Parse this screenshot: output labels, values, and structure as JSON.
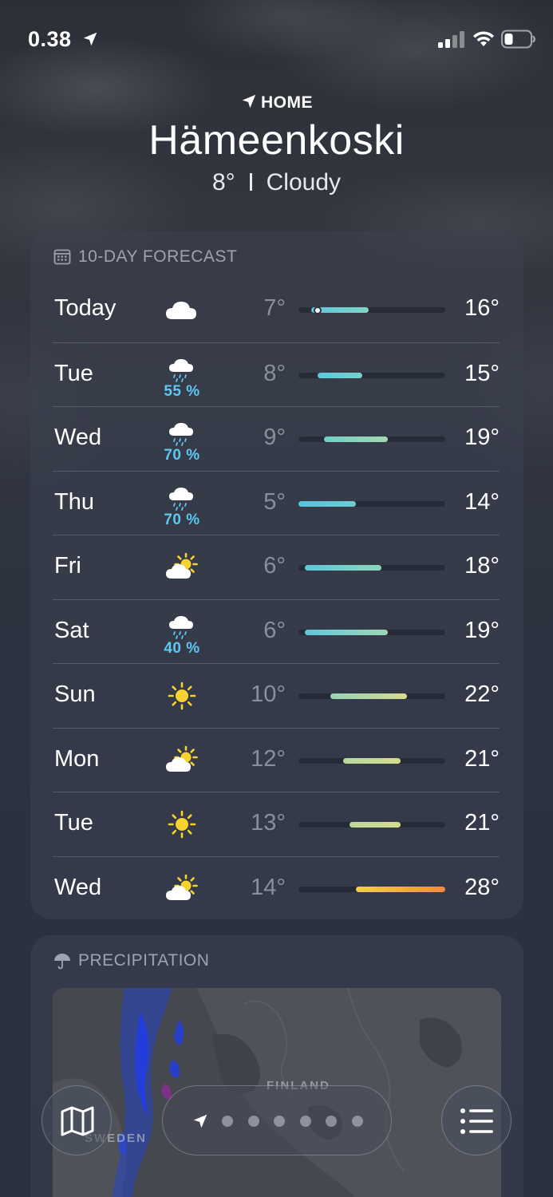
{
  "status_bar": {
    "time": "0.38",
    "location_icon": "location-arrow-icon",
    "signal_icon": "cellular-signal-icon",
    "wifi_icon": "wifi-icon",
    "battery_icon": "battery-icon"
  },
  "location": {
    "label": "HOME",
    "city": "Hämeenkoski",
    "current_temp": "8°",
    "condition": "Cloudy"
  },
  "forecast": {
    "header": "10-DAY FORECAST",
    "icon": "calendar-icon",
    "scale": {
      "min": 5,
      "max": 28
    },
    "days": [
      {
        "day": "Today",
        "icon": "cloud-icon",
        "pop": "",
        "low": "7°",
        "high": "16°",
        "low_val": 7,
        "high_val": 16,
        "current": 8,
        "colors": [
          "#5ec8dc",
          "#7ed4c8"
        ]
      },
      {
        "day": "Tue",
        "icon": "cloud-rain-icon",
        "pop": "55 %",
        "low": "8°",
        "high": "15°",
        "low_val": 8,
        "high_val": 15,
        "colors": [
          "#5ec8dc",
          "#78d0cc"
        ]
      },
      {
        "day": "Wed",
        "icon": "cloud-rain-icon",
        "pop": "70 %",
        "low": "9°",
        "high": "19°",
        "low_val": 9,
        "high_val": 19,
        "colors": [
          "#72cec8",
          "#a4d8b0"
        ]
      },
      {
        "day": "Thu",
        "icon": "cloud-rain-icon",
        "pop": "70 %",
        "low": "5°",
        "high": "14°",
        "low_val": 5,
        "high_val": 14,
        "colors": [
          "#56c4e0",
          "#70cccf"
        ]
      },
      {
        "day": "Fri",
        "icon": "partly-sunny-icon",
        "pop": "",
        "low": "6°",
        "high": "18°",
        "low_val": 6,
        "high_val": 18,
        "colors": [
          "#5ec8dc",
          "#8ed4bc"
        ]
      },
      {
        "day": "Sat",
        "icon": "cloud-rain-icon",
        "pop": "40 %",
        "low": "6°",
        "high": "19°",
        "low_val": 6,
        "high_val": 19,
        "colors": [
          "#5ec8dc",
          "#a0d8b2"
        ]
      },
      {
        "day": "Sun",
        "icon": "sun-icon",
        "pop": "",
        "low": "10°",
        "high": "22°",
        "low_val": 10,
        "high_val": 22,
        "colors": [
          "#94d4b8",
          "#d8dc8a"
        ]
      },
      {
        "day": "Mon",
        "icon": "partly-sunny-icon",
        "pop": "",
        "low": "12°",
        "high": "21°",
        "low_val": 12,
        "high_val": 21,
        "colors": [
          "#b6d8a0",
          "#d4dc8c"
        ]
      },
      {
        "day": "Tue",
        "icon": "sun-icon",
        "pop": "",
        "low": "13°",
        "high": "21°",
        "low_val": 13,
        "high_val": 21,
        "colors": [
          "#bcd89c",
          "#d4dc8c"
        ]
      },
      {
        "day": "Wed",
        "icon": "partly-sunny-icon",
        "pop": "",
        "low": "14°",
        "high": "28°",
        "low_val": 14,
        "high_val": 28,
        "colors": [
          "#f2d04a",
          "#f28a3c"
        ]
      }
    ]
  },
  "precipitation": {
    "header": "PRECIPITATION",
    "icon": "umbrella-icon",
    "map_labels": [
      "FINLAND",
      "SWEDEN"
    ]
  },
  "bottom_bar": {
    "map_icon": "map-icon",
    "list_icon": "list-icon",
    "page_count": 6
  }
}
